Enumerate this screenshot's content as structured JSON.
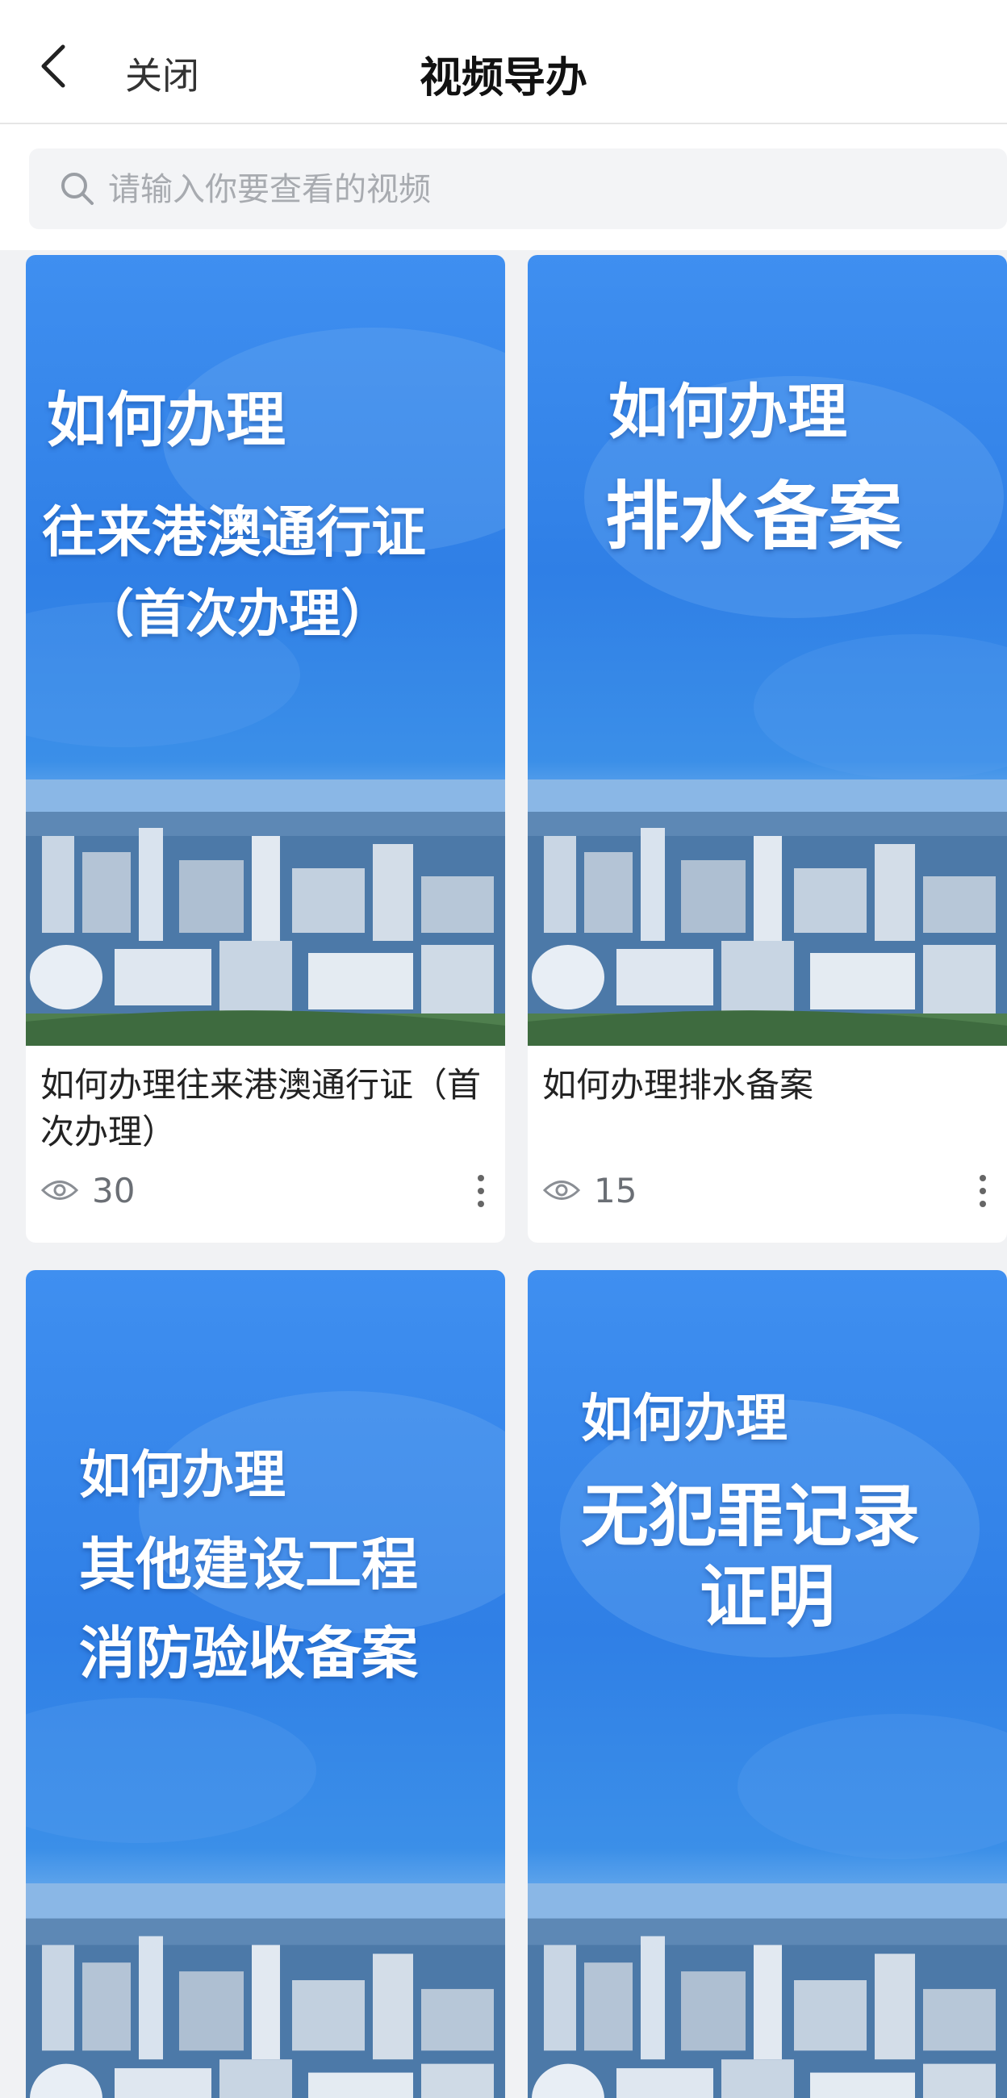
{
  "header": {
    "close_label": "关闭",
    "title": "视频导办"
  },
  "search": {
    "placeholder": "请输入你要查看的视频"
  },
  "videos": [
    {
      "cover_lines": [
        "如何办理",
        "往来港澳通行证",
        "（首次办理）"
      ],
      "title": "如何办理往来港澳通行证（首次办理）",
      "views": "30"
    },
    {
      "cover_lines": [
        "如何办理",
        "排水备案"
      ],
      "title": "如何办理排水备案",
      "views": "15"
    },
    {
      "cover_lines": [
        "如何办理",
        "其他建设工程",
        "消防验收备案"
      ]
    },
    {
      "cover_lines": [
        "如何办理",
        "无犯罪记录",
        "证明"
      ]
    }
  ],
  "colors": {
    "cover_blue": "#3f8ff0",
    "accent_text": "#111111",
    "muted_text": "#6b6f75"
  },
  "icons": [
    "chevron-left-icon",
    "search-icon",
    "eye-icon",
    "more-vertical-icon"
  ]
}
